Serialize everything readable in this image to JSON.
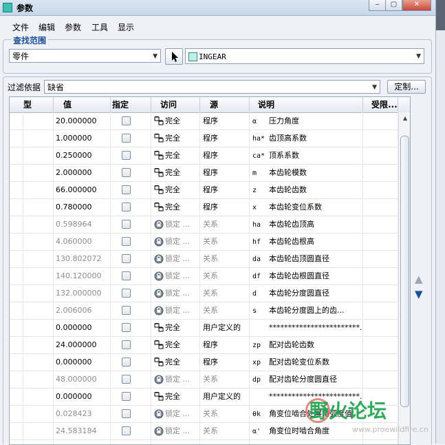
{
  "window": {
    "title": "参数",
    "min": "‒",
    "max": "▢",
    "close": "✕"
  },
  "menu": [
    "文件",
    "编辑",
    "参数",
    "工具",
    "显示"
  ],
  "scope": {
    "label": "查找范围",
    "type_value": "零件",
    "model_value": "INGEAR"
  },
  "filter": {
    "label": "过滤依据",
    "value": "缺省",
    "customize_label": "定制..."
  },
  "columns": [
    "型",
    "值",
    "指定",
    "访问",
    "源",
    "说明",
    "受限..."
  ],
  "rows": [
    {
      "value": "20.000000",
      "access": "完全",
      "source": "程序",
      "sym": "α",
      "desc": "压力角度",
      "gray": false
    },
    {
      "value": "1.000000",
      "access": "完全",
      "source": "程序",
      "sym": "ha*",
      "desc": "齿顶高系数",
      "gray": false
    },
    {
      "value": "0.250000",
      "access": "完全",
      "source": "程序",
      "sym": "ca*",
      "desc": "顶系系数",
      "gray": false
    },
    {
      "value": "2.000000",
      "access": "完全",
      "source": "程序",
      "sym": "m",
      "desc": "本齿轮模数",
      "gray": false
    },
    {
      "value": "66.000000",
      "access": "完全",
      "source": "程序",
      "sym": "z",
      "desc": "本齿轮齿数",
      "gray": false
    },
    {
      "value": "0.780000",
      "access": "完全",
      "source": "程序",
      "sym": "x",
      "desc": "本齿轮变位系数",
      "gray": false
    },
    {
      "value": "0.598964",
      "access": "锁定 ...",
      "source": "关系",
      "sym": "ha",
      "desc": "本齿轮齿顶高",
      "gray": true
    },
    {
      "value": "4.060000",
      "access": "锁定 ...",
      "source": "关系",
      "sym": "hf",
      "desc": "本齿轮齿根高",
      "gray": true
    },
    {
      "value": "130.802072",
      "access": "锁定 ...",
      "source": "关系",
      "sym": "da",
      "desc": "本齿轮齿顶圆直径",
      "gray": true
    },
    {
      "value": "140.120000",
      "access": "锁定 ...",
      "source": "关系",
      "sym": "df",
      "desc": "本齿轮齿根圆直径",
      "gray": true
    },
    {
      "value": "132.000000",
      "access": "锁定 ...",
      "source": "关系",
      "sym": "d",
      "desc": "本齿轮分度圆直径",
      "gray": true
    },
    {
      "value": "2.006006",
      "access": "锁定 ...",
      "source": "关系",
      "sym": "s",
      "desc": "本齿轮分度圆上的齿...",
      "gray": true
    },
    {
      "value": "0.000000",
      "access": "完全",
      "source": "用户定义的",
      "sym": "",
      "desc": "************************...",
      "gray": false
    },
    {
      "value": "24.000000",
      "access": "完全",
      "source": "程序",
      "sym": "zp",
      "desc": "配对齿轮齿数",
      "gray": false
    },
    {
      "value": "0.000000",
      "access": "完全",
      "source": "程序",
      "sym": "xp",
      "desc": "配对齿轮变位系数",
      "gray": false
    },
    {
      "value": "48.000000",
      "access": "锁定 ...",
      "source": "关系",
      "sym": "dp",
      "desc": "配对齿轮分度圆直径",
      "gray": true
    },
    {
      "value": "0.000000",
      "access": "完全",
      "source": "用户定义的",
      "sym": "",
      "desc": "************************...",
      "gray": false
    },
    {
      "value": "0.028423",
      "access": "锁定 ...",
      "source": "关系",
      "sym": "θk",
      "desc": "角变位啮合处展角弧度值",
      "gray": true
    },
    {
      "value": "24.583184",
      "access": "锁定 ...",
      "source": "关系",
      "sym": "α'",
      "desc": "角变位时啮合角度",
      "gray": true
    },
    {
      "value": "",
      "access": "",
      "source": "",
      "sym": "",
      "desc": "",
      "gray": true
    }
  ],
  "side_arrows": {
    "up": "▲",
    "down": "▼"
  },
  "watermark": {
    "text": "野火论坛",
    "url": "www.proewildfire.cn"
  }
}
